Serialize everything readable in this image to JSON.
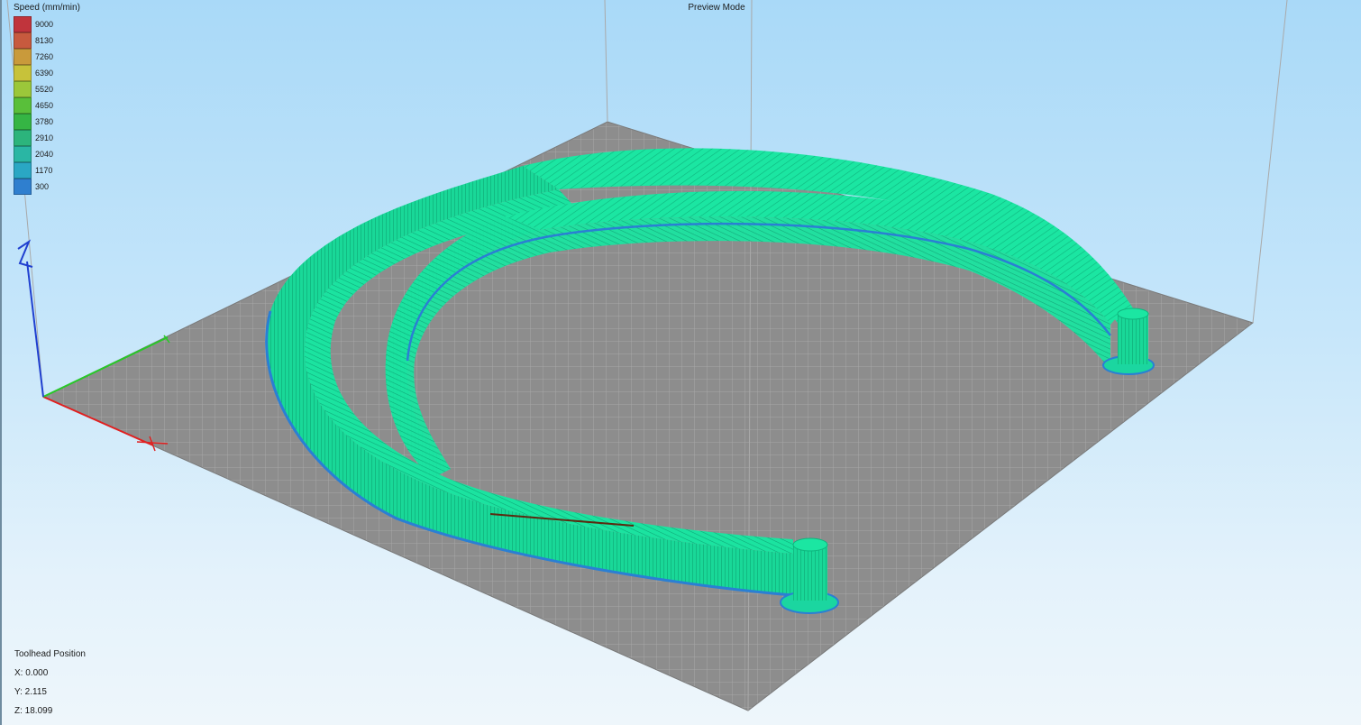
{
  "viewport": {
    "mode_label": "Preview Mode"
  },
  "legend": {
    "title": "Speed (mm/min)",
    "items": [
      {
        "value": "9000",
        "color": "#c0343c"
      },
      {
        "value": "8130",
        "color": "#c75a3e"
      },
      {
        "value": "7260",
        "color": "#c99a3b"
      },
      {
        "value": "6390",
        "color": "#c7c23a"
      },
      {
        "value": "5520",
        "color": "#9bc73a"
      },
      {
        "value": "4650",
        "color": "#59bf3a"
      },
      {
        "value": "3780",
        "color": "#35b544"
      },
      {
        "value": "2910",
        "color": "#2cb47c"
      },
      {
        "value": "2040",
        "color": "#2ab6a4"
      },
      {
        "value": "1170",
        "color": "#2aa7c4"
      },
      {
        "value": "300",
        "color": "#2f7fcf"
      }
    ]
  },
  "toolhead": {
    "title": "Toolhead Position",
    "x": "X: 0.000",
    "y": "Y: 2.115",
    "z": "Z: 18.099"
  },
  "model": {
    "extrusion_color": "#19e6a0",
    "shell_color": "#14c98a",
    "outline_color": "#2a7fd4"
  },
  "axes": {
    "x_color": "#e02020",
    "y_color": "#28c828",
    "z_color": "#2040d0"
  }
}
